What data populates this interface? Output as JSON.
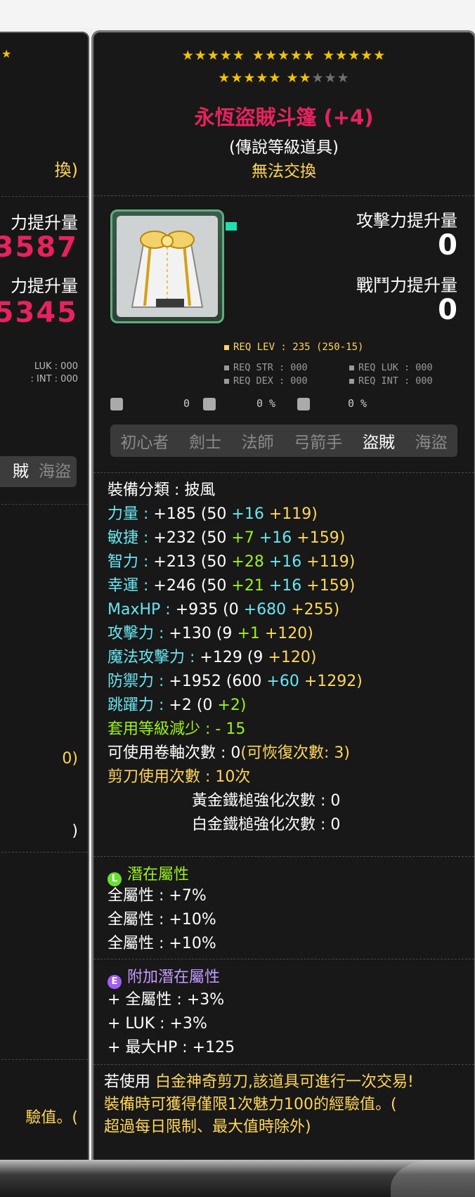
{
  "left_panel": {
    "star": "★",
    "trade_fragment": "換)",
    "atk_label_fragment": "力提升量",
    "atk_value_fragment": "3587",
    "cp_label_fragment": "力提升量",
    "cp_value_fragment": "5345",
    "req_luk_fragment": "LUK : 000",
    "req_int_fragment": ": INT : 000",
    "job_active": "賊",
    "job_last": "海盜",
    "stat_fragment_1": "0)",
    "stat_fragment_2": ")",
    "desc_fragment": "驗值。("
  },
  "item": {
    "stars_row1": [
      "★★★★★",
      "★★★★★",
      "★★★★★"
    ],
    "stars_row2_on": "★★★★★ ★★",
    "stars_row2_off": "★★★",
    "name": "永恆盜賊斗篷 (+4)",
    "rank": "(傳說等級道具)",
    "trade": "無法交換",
    "attack_increase_label": "攻擊力提升量",
    "attack_increase_value": "0",
    "combat_power_label": "戰鬥力提升量",
    "combat_power_value": "0",
    "req_lev": "REQ LEV : 235 (250-15)",
    "req_str": "REQ STR : 000",
    "req_luk": "REQ LUK : 000",
    "req_dex": "REQ DEX : 000",
    "req_int": "REQ INT : 000",
    "mini_1": "0",
    "mini_2": "0 %",
    "mini_3": "0 %"
  },
  "jobs": [
    "初心者",
    "劍士",
    "法師",
    "弓箭手",
    "盜賊",
    "海盜"
  ],
  "jobs_active": "盜賊",
  "stats": {
    "category": "裝備分類 : 披風",
    "str_label": "力量 :",
    "str_total": "+185",
    "str_base": "(50",
    "str_b": "+16",
    "str_c": "+119)",
    "dex_label": "敏捷 :",
    "dex_total": "+232",
    "dex_base": "(50",
    "dex_a": "+7",
    "dex_b": "+16",
    "dex_c": "+159)",
    "int_label": "智力 :",
    "int_total": "+213",
    "int_base": "(50",
    "int_a": "+28",
    "int_b": "+16",
    "int_c": "+119)",
    "luk_label": "幸運 :",
    "luk_total": "+246",
    "luk_base": "(50",
    "luk_a": "+21",
    "luk_b": "+16",
    "luk_c": "+159)",
    "hp_label": "MaxHP :",
    "hp_total": "+935",
    "hp_base": "(0",
    "hp_b": "+680",
    "hp_c": "+255)",
    "atk_label": "攻擊力 :",
    "atk_total": "+130",
    "atk_base": "(9",
    "atk_a": "+1",
    "atk_c": "+120)",
    "matk_label": "魔法攻擊力 :",
    "matk_total": "+129",
    "matk_base": "(9",
    "matk_c": "+120)",
    "def_label": "防禦力 :",
    "def_total": "+1952",
    "def_base": "(600",
    "def_b": "+60",
    "def_c": "+1292)",
    "jump_label": "跳躍力 :",
    "jump_total": "+2",
    "jump_base": "(0",
    "jump_a": "+2)",
    "level_reduce": "套用等級減少 : - 15",
    "scroll_count": "可使用卷軸次數 : 0",
    "scroll_recover": "(可恢復次數: 3)",
    "scissors": "剪刀使用次數 : 10次",
    "gold_hammer": "黃金鐵槌強化次數 : 0",
    "plat_hammer": "白金鐵槌強化次數 : 0"
  },
  "potential": {
    "icon_letter": "L",
    "label": "潛在屬性",
    "lines": [
      "全屬性 : +7%",
      "全屬性 : +10%",
      "全屬性 : +10%"
    ]
  },
  "additional": {
    "icon_letter": "E",
    "label": "附加潛在屬性",
    "lines": [
      "+ 全屬性 : +3%",
      "+ LUK : +3%",
      "+ 最大HP : +125"
    ]
  },
  "description": {
    "prefix": "若使用",
    "rest1": " 白金神奇剪刀,該道具可進行一次交易!",
    "line2": " 裝備時可獲得僅限1次魅力100的經驗值。(",
    "line3": "超過每日限制、最大值時除外)"
  }
}
